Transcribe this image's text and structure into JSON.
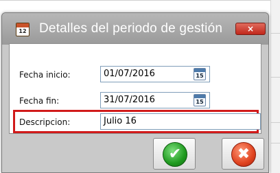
{
  "window": {
    "title": "Detalles del periodo de gestión",
    "app_icon": "calendar-icon",
    "app_icon_number": "12",
    "close_label": "×"
  },
  "form": {
    "fecha_inicio": {
      "label": "Fecha inicio:",
      "value": "01/07/2016",
      "calendar_number": "15"
    },
    "fecha_fin": {
      "label": "Fecha fin:",
      "value": "31/07/2016",
      "calendar_number": "15"
    },
    "descripcion": {
      "label": "Descripcion:",
      "value": "Julio 16"
    }
  },
  "buttons": {
    "ok_icon": "check-icon",
    "ok_glyph": "✔",
    "cancel_icon": "cancel-icon",
    "cancel_glyph": "✖"
  },
  "colors": {
    "highlight": "#d11a1a",
    "ok": "#1f9a1f",
    "cancel": "#e0431f"
  }
}
